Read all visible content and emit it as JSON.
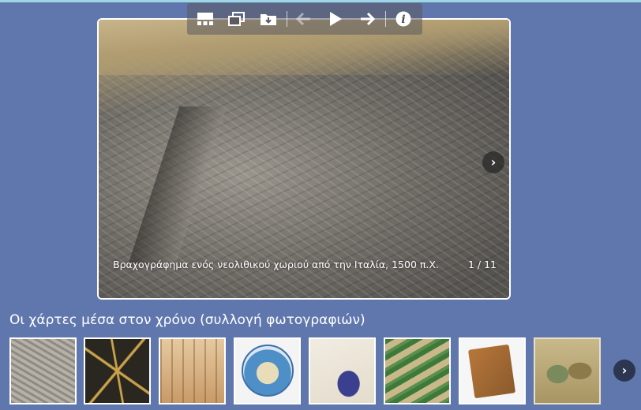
{
  "viewer": {
    "caption": "Βραχογράφημα ενός νεολιθικού χωριού από την Ιταλία, 1500 π.Χ.",
    "counter": "1 / 11"
  },
  "toolbar": {
    "buttons": [
      {
        "name": "thumbnails",
        "icon": "grid-icon"
      },
      {
        "name": "fullscreen",
        "icon": "window-icon"
      },
      {
        "name": "download",
        "icon": "folder-download-icon"
      },
      {
        "name": "previous",
        "icon": "arrow-left-icon",
        "disabled": true
      },
      {
        "name": "play",
        "icon": "play-icon"
      },
      {
        "name": "next",
        "icon": "arrow-right-icon"
      },
      {
        "name": "info",
        "icon": "info-icon"
      }
    ]
  },
  "gallery": {
    "title": "Οι χάρτες μέσα στον χρόνο (συλλογή φωτογραφιών)",
    "thumbnail_count": 8
  },
  "colors": {
    "background": "#5f77ad",
    "accent_line": "#9fd6e3"
  }
}
